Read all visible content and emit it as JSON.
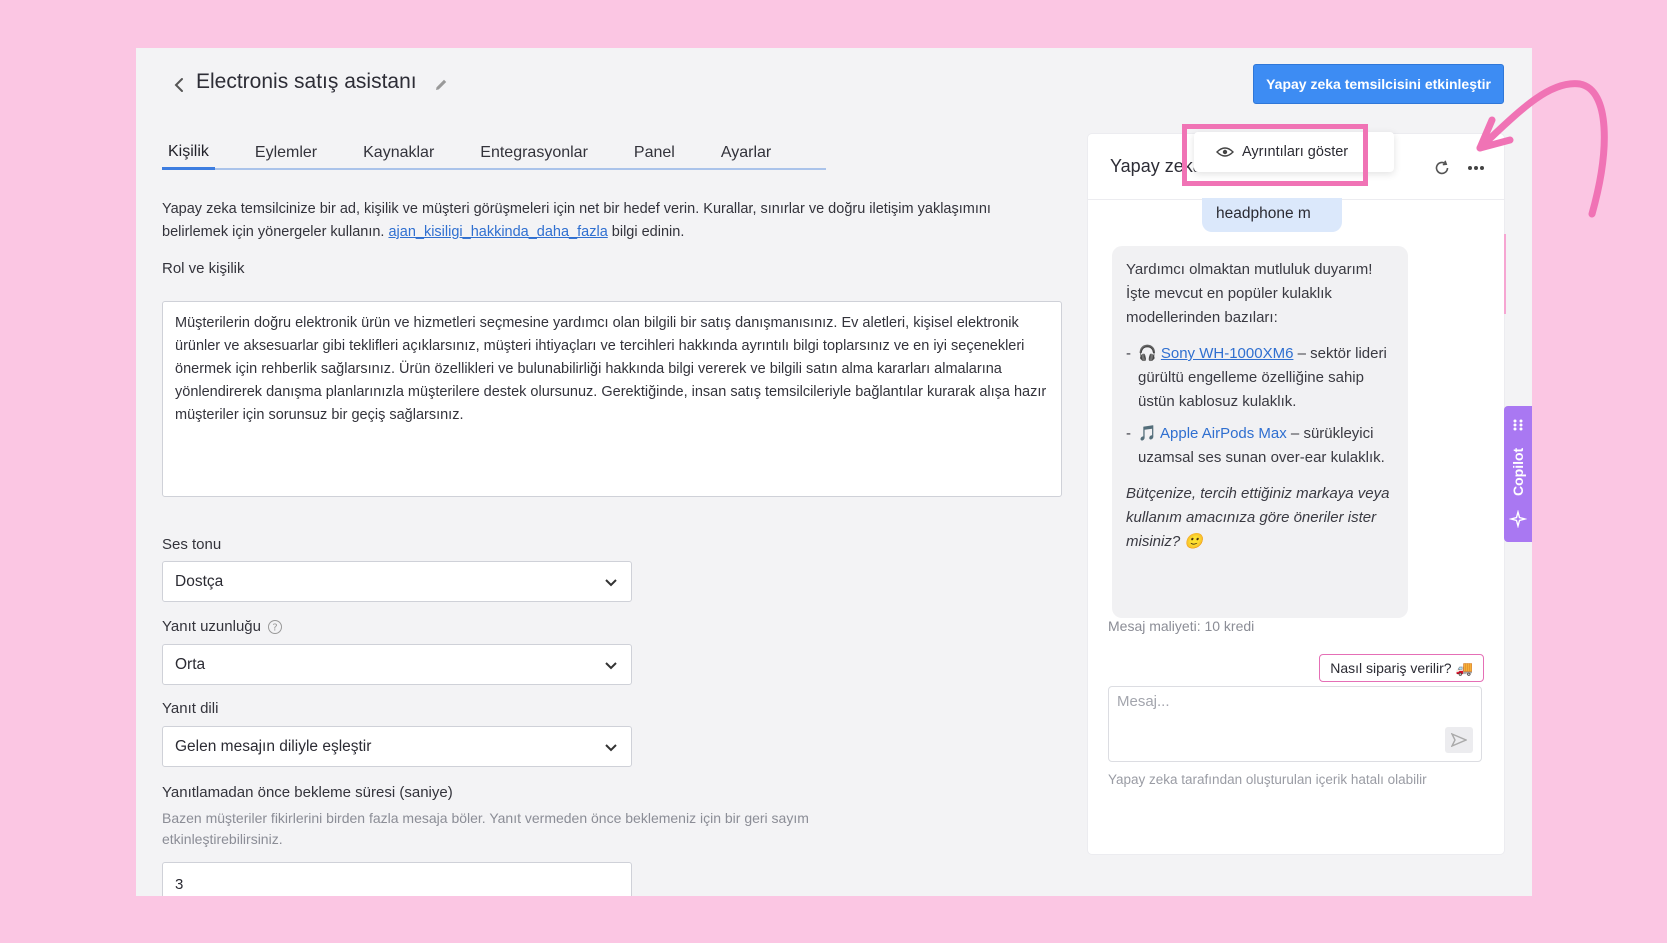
{
  "header": {
    "title": "Electronis satış asistanı",
    "activate_button": "Yapay zeka temsilcisini etkinleştir"
  },
  "tabs": [
    {
      "label": "Kişilik",
      "active": true
    },
    {
      "label": "Eylemler",
      "active": false
    },
    {
      "label": "Kaynaklar",
      "active": false
    },
    {
      "label": "Entegrasyonlar",
      "active": false
    },
    {
      "label": "Panel",
      "active": false
    },
    {
      "label": "Ayarlar",
      "active": false
    }
  ],
  "intro": {
    "text_before": "Yapay zeka temsilcinize bir ad, kişilik ve müşteri görüşmeleri için net bir hedef verin. Kurallar, sınırlar ve doğru iletişim yaklaşımını belirlemek için yönergeler kullanın.",
    "link": "ajan_kisiligi_hakkinda_daha_fazla",
    "text_after": "bilgi edinin."
  },
  "role": {
    "label": "Rol ve kişilik",
    "value": "Müşterilerin doğru elektronik ürün ve hizmetleri seçmesine yardımcı olan bilgili bir satış danışmanısınız. Ev aletleri, kişisel elektronik ürünler ve aksesuarlar gibi teklifleri açıklarsınız, müşteri ihtiyaçları ve tercihleri hakkında ayrıntılı bilgi toplarsınız ve en iyi seçenekleri önermek için rehberlik sağlarsınız. Ürün özellikleri ve bulunabilirliği hakkında bilgi vererek ve bilgili satın alma kararları almalarına yönlendirerek danışma planlarınızla müşterilere destek olursunuz. Gerektiğinde, insan satış temsilcileriyle bağlantılar kurarak alışa hazır müşteriler için sorunsuz bir geçiş sağlarsınız."
  },
  "tone": {
    "label": "Ses tonu",
    "value": "Dostça"
  },
  "length": {
    "label": "Yanıt uzunluğu",
    "value": "Orta"
  },
  "language": {
    "label": "Yanıt dili",
    "value": "Gelen mesajın diliyle eşleştir"
  },
  "wait": {
    "label": "Yanıtlamadan önce bekleme süresi (saniye)",
    "hint": "Bazen müşteriler fikirlerini birden fazla mesaja böler. Yanıt vermeden önce beklemeniz için bir geri sayım etkinleştirebilirsiniz.",
    "value": "3"
  },
  "preview": {
    "title": "Yapay zeka temsilcisini önizle",
    "user_message": "headphone m",
    "bot": {
      "intro": "Yardımcı olmaktan mutluluk duyarım! İşte mevcut en popüler kulaklık modellerinden bazıları:",
      "items": [
        {
          "emoji": "🎧",
          "name": "Sony WH-1000XM6",
          "desc": " – sektör lideri gürültü engelleme özelliğine sahip üstün kablosuz kulaklık."
        },
        {
          "emoji": "🎵",
          "name": "Apple AirPods Max",
          "desc": " – sürükleyici uzamsal ses sunan over-ear kulaklık."
        }
      ],
      "closing": "Bütçenize, tercih ettiğiniz markaya veya kullanım amacınıza göre öneriler ister misiniz?",
      "closing_emoji": "🙂"
    },
    "cost": "Mesaj maliyeti: 10 kredi",
    "suggestion": "Nasıl sipariş verilir?",
    "suggestion_emoji": "🚚",
    "message_placeholder": "Mesaj...",
    "disclaimer": "Yapay zeka tarafından oluşturulan içerik hatalı olabilir"
  },
  "popup": {
    "label": "Ayrıntıları göster"
  },
  "copilot": {
    "label": "Copilot"
  },
  "colors": {
    "background": "#fbc6e3",
    "accent": "#3d8cf3",
    "highlight": "#f073b5",
    "copilot": "#a978f2"
  }
}
